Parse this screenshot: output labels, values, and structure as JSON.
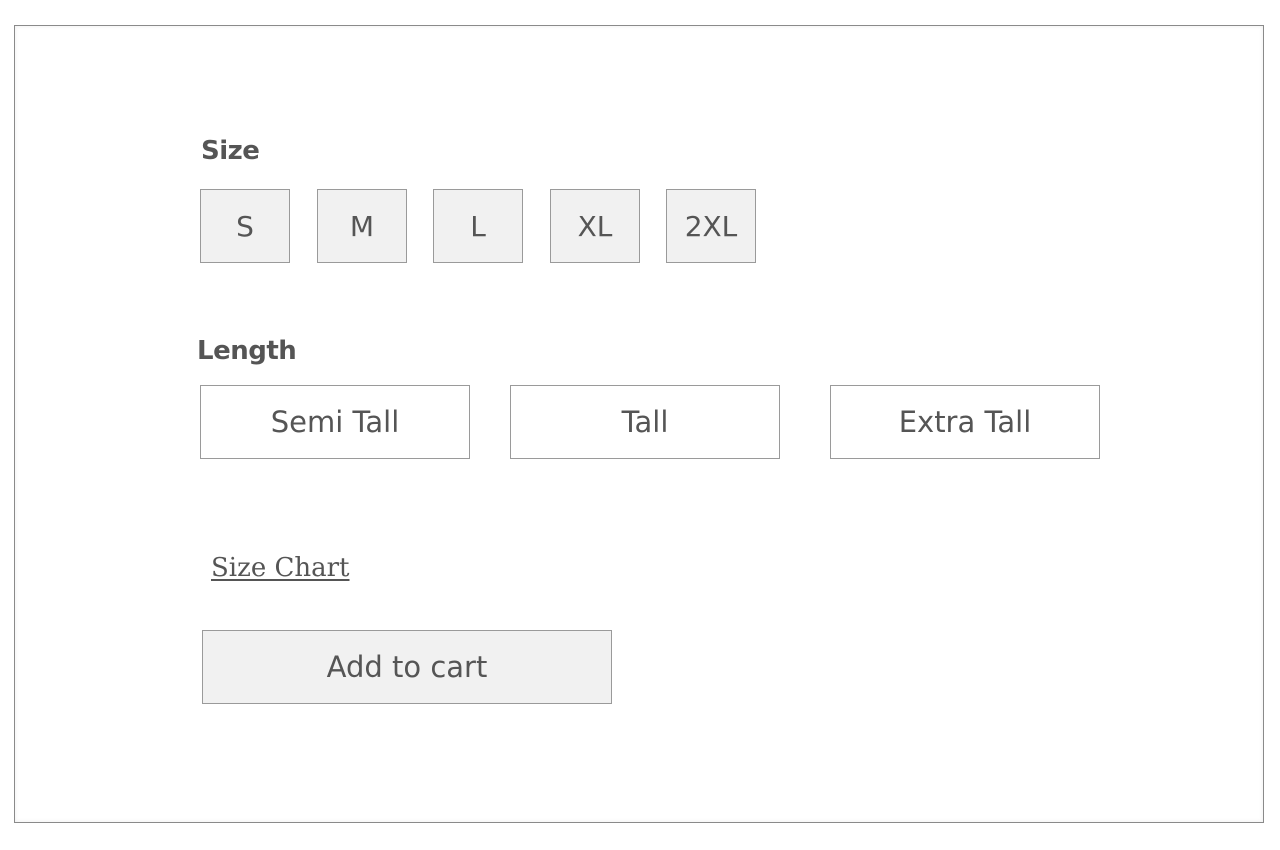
{
  "size": {
    "label": "Size",
    "options": [
      "S",
      "M",
      "L",
      "XL",
      "2XL"
    ]
  },
  "length": {
    "label": "Length",
    "options": [
      "Semi Tall",
      "Tall",
      "Extra Tall"
    ]
  },
  "links": {
    "size_chart": "Size Chart"
  },
  "actions": {
    "add_to_cart": "Add to cart"
  },
  "colors": {
    "text": "#555555",
    "border": "#9a9a9a",
    "button_fill": "#f1f1f1",
    "background": "#ffffff"
  }
}
